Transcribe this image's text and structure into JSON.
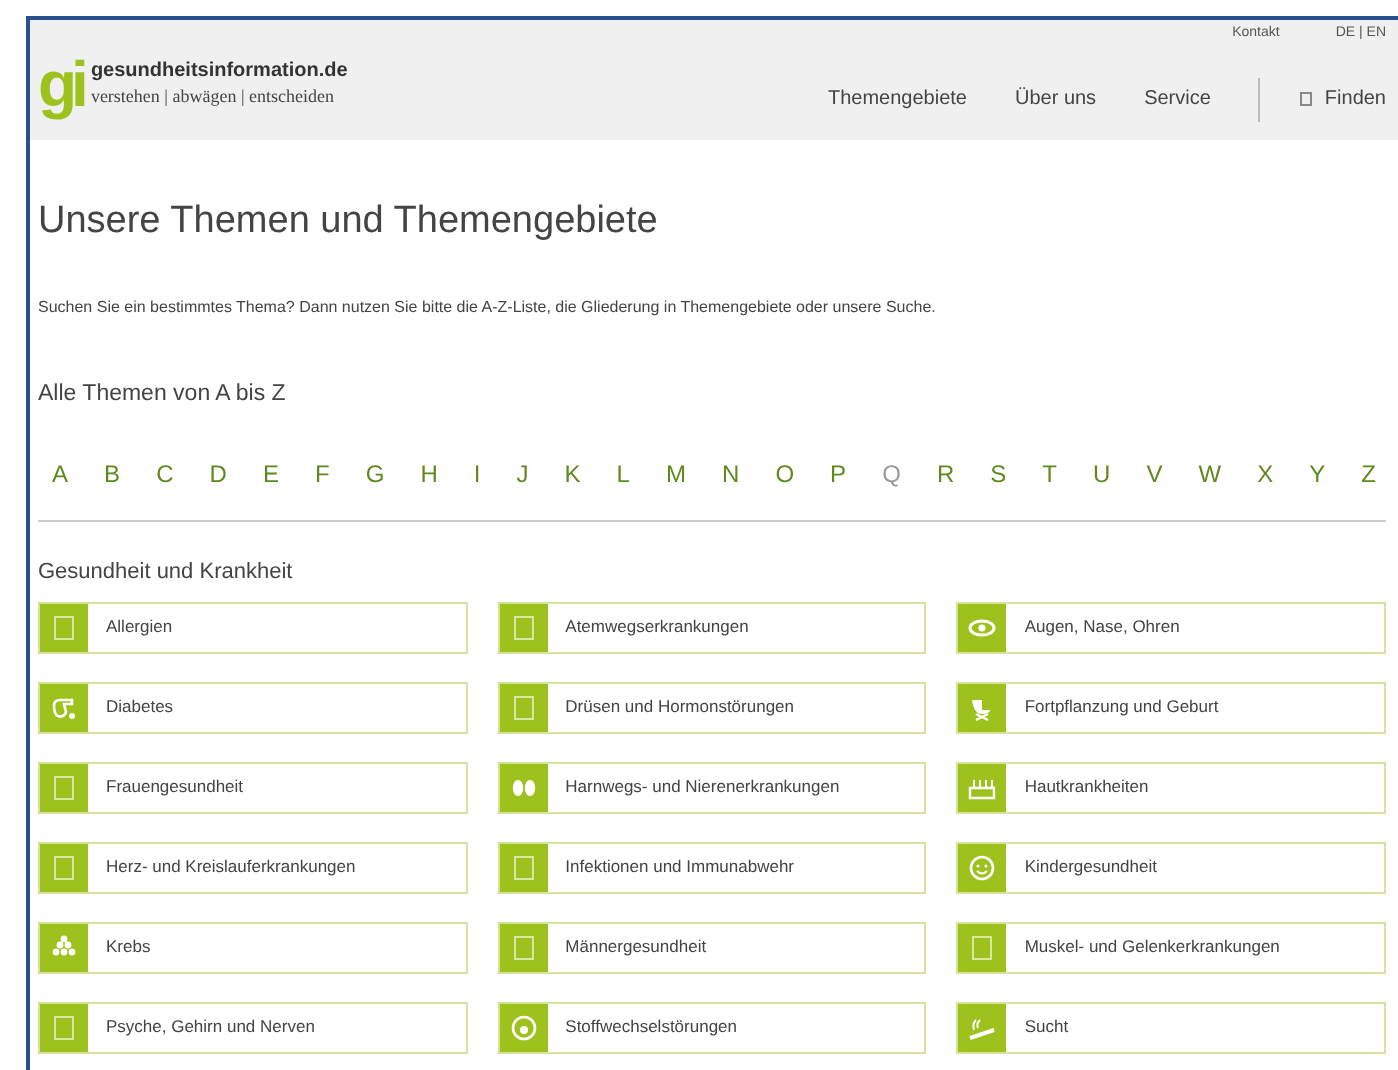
{
  "header": {
    "logo_mark": "gi",
    "site_name": "gesundheitsinformation.de",
    "tagline": "verstehen | abwägen | entscheiden",
    "top_links": [
      "Kontakt",
      "DE | EN"
    ],
    "nav": [
      "Themengebiete",
      "Über uns",
      "Service"
    ],
    "search_label": "Finden"
  },
  "title": "Unsere Themen und Themengebiete",
  "intro": "Suchen Sie ein bestimmtes Thema? Dann nutzen Sie bitte die A-Z-Liste, die Gliederung in Themengebiete oder unsere Suche.",
  "az": {
    "heading": "Alle Themen von A bis Z",
    "letters": [
      {
        "letter": "A",
        "disabled": false
      },
      {
        "letter": "B",
        "disabled": false
      },
      {
        "letter": "C",
        "disabled": false
      },
      {
        "letter": "D",
        "disabled": false
      },
      {
        "letter": "E",
        "disabled": false
      },
      {
        "letter": "F",
        "disabled": false
      },
      {
        "letter": "G",
        "disabled": false
      },
      {
        "letter": "H",
        "disabled": false
      },
      {
        "letter": "I",
        "disabled": false
      },
      {
        "letter": "J",
        "disabled": false
      },
      {
        "letter": "K",
        "disabled": false
      },
      {
        "letter": "L",
        "disabled": false
      },
      {
        "letter": "M",
        "disabled": false
      },
      {
        "letter": "N",
        "disabled": false
      },
      {
        "letter": "O",
        "disabled": false
      },
      {
        "letter": "P",
        "disabled": false
      },
      {
        "letter": "Q",
        "disabled": true
      },
      {
        "letter": "R",
        "disabled": false
      },
      {
        "letter": "S",
        "disabled": false
      },
      {
        "letter": "T",
        "disabled": false
      },
      {
        "letter": "U",
        "disabled": false
      },
      {
        "letter": "V",
        "disabled": false
      },
      {
        "letter": "W",
        "disabled": false
      },
      {
        "letter": "X",
        "disabled": false
      },
      {
        "letter": "Y",
        "disabled": false
      },
      {
        "letter": "Z",
        "disabled": false
      }
    ]
  },
  "section": {
    "heading": "Gesundheit und Krankheit",
    "topics": [
      {
        "label": "Allergien"
      },
      {
        "label": "Atemwegserkrankungen"
      },
      {
        "label": "Augen, Nase, Ohren"
      },
      {
        "label": "Diabetes"
      },
      {
        "label": "Drüsen und Hormonstörungen"
      },
      {
        "label": "Fortpflanzung und Geburt"
      },
      {
        "label": "Frauengesundheit"
      },
      {
        "label": "Harnwegs- und Nierenerkrankungen"
      },
      {
        "label": "Hautkrankheiten"
      },
      {
        "label": "Herz- und Kreislauferkrankungen"
      },
      {
        "label": "Infektionen und Immunabwehr"
      },
      {
        "label": "Kindergesundheit"
      },
      {
        "label": "Krebs"
      },
      {
        "label": "Männergesundheit"
      },
      {
        "label": "Muskel- und Gelenkerkrankungen"
      },
      {
        "label": "Psyche, Gehirn und Nerven"
      },
      {
        "label": "Stoffwechselstörungen"
      },
      {
        "label": "Sucht"
      }
    ]
  }
}
